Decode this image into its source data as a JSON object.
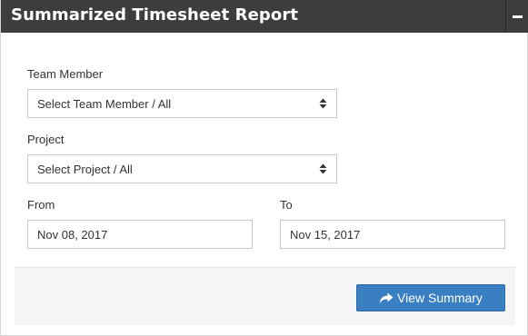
{
  "panel": {
    "title": "Summarized Timesheet Report",
    "collapse_icon": "minus-icon"
  },
  "form": {
    "team_member": {
      "label": "Team Member",
      "value": "Select Team Member / All"
    },
    "project": {
      "label": "Project",
      "value": "Select Project / All"
    },
    "from": {
      "label": "From",
      "value": "Nov 08, 2017"
    },
    "to": {
      "label": "To",
      "value": "Nov 15, 2017"
    }
  },
  "actions": {
    "view_summary_label": "View Summary",
    "view_summary_icon": "share-arrow-icon",
    "button_color": "#3a7fc1"
  },
  "theme": {
    "header_bg": "#3d3d3d",
    "footer_bg": "#f5f5f5"
  }
}
